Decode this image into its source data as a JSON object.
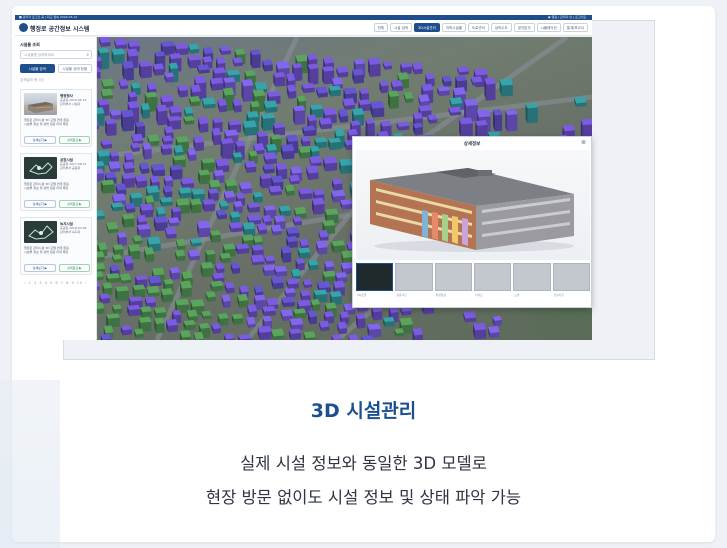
{
  "app": {
    "topbar_left": "■ 관리자 로그인 중  |  최근 접속 2024-03-12",
    "topbar_right": "▣ 알림  |  관리자 님  |  로그아웃",
    "title": "행정로 공간정보 시스템"
  },
  "menu": [
    {
      "label": "전체",
      "active": false
    },
    {
      "label": "시설 검색",
      "active": false
    },
    {
      "label": "3D시설관리",
      "active": true
    },
    {
      "label": "지하시설물",
      "active": false
    },
    {
      "label": "도로관리",
      "active": false
    },
    {
      "label": "상하수도",
      "active": false
    },
    {
      "label": "공간분석",
      "active": false
    },
    {
      "label": "시뮬레이션",
      "active": false
    },
    {
      "label": "통계/보고서",
      "active": false
    }
  ],
  "sidebar": {
    "title": "시설물 조회",
    "search_placeholder": "시설물명 입력하세요",
    "tabs": [
      {
        "label": "시설물 검색",
        "active": true
      },
      {
        "label": "시설물 상태 현황",
        "active": false
      }
    ],
    "count_label": "검색결과 총 3건",
    "items": [
      {
        "name": "행정청사",
        "meta1": "준공일 2019.05.14",
        "meta2": "관리부서 시설과",
        "desc": "행정로 관리시설 3D 모델 연계 완료",
        "desc2": "시설물 정보 및 상태 점검 이력 확인",
        "btn1": "상세보기 ▶",
        "btn2": "상태점검 ▶"
      },
      {
        "name": "공원시설",
        "meta1": "준공일 2017.08.21",
        "meta2": "관리부서 공원과",
        "desc": "행정로 관리시설 3D 모델 연계 완료",
        "desc2": "시설물 정보 및 상태 점검 이력 확인",
        "btn1": "상세보기 ▶",
        "btn2": "상태점검 ▶"
      },
      {
        "name": "녹지시설",
        "meta1": "준공일 2016.03.09",
        "meta2": "관리부서 녹지과",
        "desc": "행정로 관리시설 3D 모델 연계 완료",
        "desc2": "시설물 정보 및 상태 점검 이력 확인",
        "btn1": "상세보기 ▶",
        "btn2": "상태점검 ▶"
      }
    ],
    "pager": "‹ 1 2 3 4 5 6 7 8 9 10 ›"
  },
  "popup": {
    "title": "상세정보",
    "close": "⊗",
    "thumbs": [
      {
        "label": "3D모델",
        "selected": true
      },
      {
        "label": "항공사진",
        "selected": false
      },
      {
        "label": "위성영상",
        "selected": false
      },
      {
        "label": "지적도",
        "selected": false
      },
      {
        "label": "도면",
        "selected": false
      },
      {
        "label": "현장사진",
        "selected": false
      }
    ]
  },
  "caption": {
    "heading": "3D 시설관리",
    "line1": "실제 시설 정보와 동일한 3D 모델로",
    "line2": "현장 방문 없이도 시설 정보 및 상태 파악 가능"
  },
  "colors": {
    "brand": "#1c4f8f",
    "building_purple": "#6a4fc4",
    "building_teal": "#2f8f95",
    "building_green": "#4e8f52"
  }
}
